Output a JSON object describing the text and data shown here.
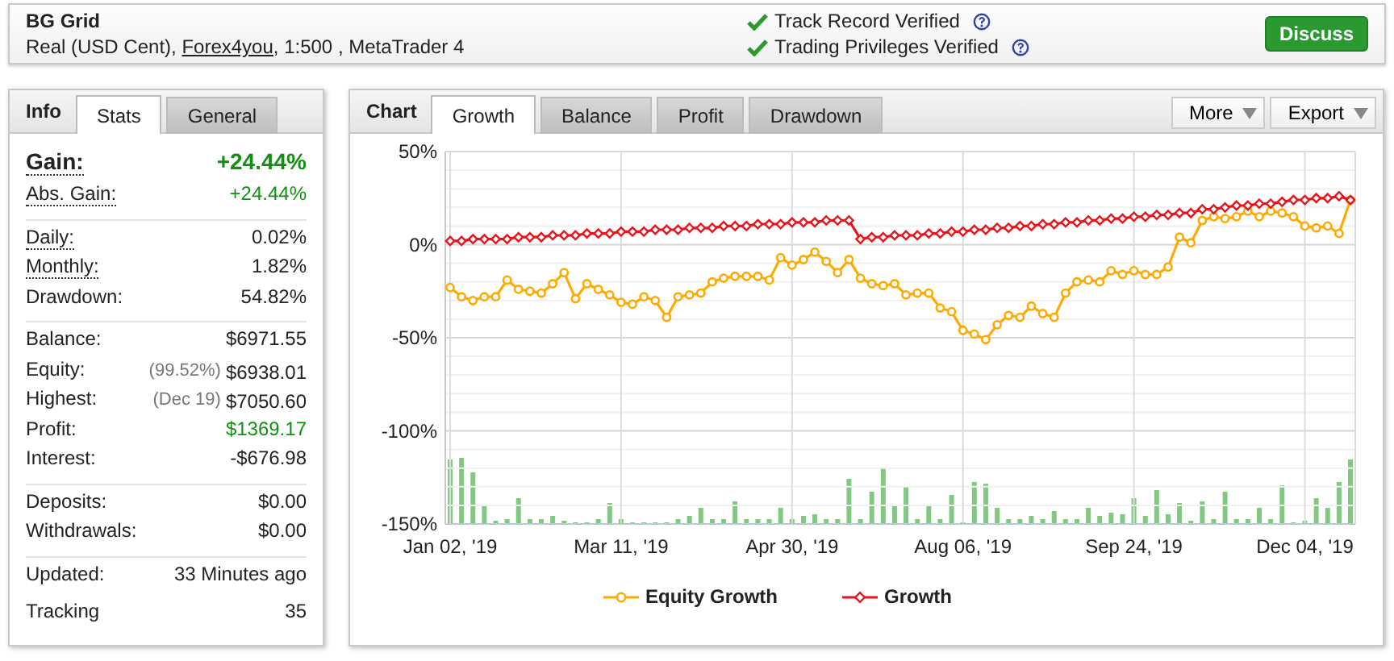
{
  "header": {
    "title": "BG Grid",
    "account": {
      "prefix": "Real (USD Cent), ",
      "link": "Forex4you",
      "suffix": ", 1:500 , MetaTrader 4"
    },
    "verifications": [
      {
        "label": "Track Record Verified",
        "verified": true
      },
      {
        "label": "Trading Privileges Verified",
        "verified": true
      }
    ],
    "discuss_button": "Discuss"
  },
  "info_panel": {
    "heading": "Info",
    "tabs": [
      {
        "label": "Stats",
        "selected": true
      },
      {
        "label": "General",
        "selected": false
      }
    ],
    "sections": [
      {
        "rows": [
          {
            "kind": "headline",
            "label": "Gain:",
            "dotted": true,
            "value": "+24.44%",
            "positive": true
          },
          {
            "kind": "row",
            "label": "Abs. Gain:",
            "dotted": true,
            "value": "+24.44%",
            "positive": true
          }
        ]
      },
      {
        "rows": [
          {
            "kind": "row",
            "label": "Daily:",
            "dotted": true,
            "value": "0.02%",
            "positive": false
          },
          {
            "kind": "row",
            "label": "Monthly:",
            "dotted": true,
            "value": "1.82%",
            "positive": false
          },
          {
            "kind": "row",
            "label": "Drawdown:",
            "dotted": false,
            "value": "54.82%",
            "positive": false
          }
        ]
      },
      {
        "rows": [
          {
            "kind": "row",
            "label": "Balance:",
            "dotted": false,
            "value": "$6971.55",
            "positive": false
          },
          {
            "kind": "row",
            "label": "Equity:",
            "dotted": false,
            "note": "(99.52%)",
            "value": "$6938.01",
            "positive": false
          },
          {
            "kind": "row",
            "label": "Highest:",
            "dotted": false,
            "note": "(Dec 19)",
            "value": "$7050.60",
            "positive": false
          },
          {
            "kind": "row",
            "label": "Profit:",
            "dotted": false,
            "value": "$1369.17",
            "positive": true
          },
          {
            "kind": "row",
            "label": "Interest:",
            "dotted": false,
            "value": "-$676.98",
            "positive": false
          }
        ]
      },
      {
        "rows": [
          {
            "kind": "row",
            "label": "Deposits:",
            "dotted": false,
            "value": "$0.00",
            "positive": false
          },
          {
            "kind": "row",
            "label": "Withdrawals:",
            "dotted": false,
            "value": "$0.00",
            "positive": false
          }
        ]
      },
      {
        "rows": [
          {
            "kind": "row",
            "label": "Updated:",
            "dotted": false,
            "value": "33 Minutes ago",
            "positive": false
          },
          {
            "kind": "row",
            "label": "Tracking",
            "dotted": false,
            "value": "35",
            "positive": false
          }
        ]
      }
    ]
  },
  "chart_panel": {
    "heading": "Chart",
    "tabs": [
      {
        "label": "Growth",
        "selected": true
      },
      {
        "label": "Balance",
        "selected": false
      },
      {
        "label": "Profit",
        "selected": false
      },
      {
        "label": "Drawdown",
        "selected": false
      }
    ],
    "menus": [
      "More",
      "Export"
    ],
    "chart_data": {
      "type": "line",
      "grid": true,
      "legend": "bottom",
      "categories": [
        "Jan 02, '19",
        null,
        null,
        null,
        null,
        null,
        null,
        null,
        null,
        null,
        null,
        null,
        null,
        null,
        null,
        "Mar 11, '19",
        null,
        null,
        null,
        null,
        null,
        null,
        null,
        null,
        null,
        null,
        null,
        null,
        null,
        null,
        "Apr 30, '19",
        null,
        null,
        null,
        null,
        null,
        null,
        null,
        null,
        null,
        null,
        null,
        null,
        null,
        null,
        "Aug 06, '19",
        null,
        null,
        null,
        null,
        null,
        null,
        null,
        null,
        null,
        null,
        null,
        null,
        null,
        null,
        "Sep 24, '19",
        null,
        null,
        null,
        null,
        null,
        null,
        null,
        null,
        null,
        null,
        null,
        null,
        null,
        null,
        "Dec 04, '19",
        null,
        null,
        null,
        null
      ],
      "ylim": [
        -150,
        50
      ],
      "yticks": [
        {
          "value": -150,
          "label": "-150%"
        },
        {
          "value": -100,
          "label": "-100%"
        },
        {
          "value": -50,
          "label": "-50%"
        },
        {
          "value": 0,
          "label": "0%"
        },
        {
          "value": 50,
          "label": "50%"
        }
      ],
      "series": [
        {
          "name": "Equity Growth",
          "color": "#ffaa00",
          "marker": "circle",
          "values": [
            -23,
            -28,
            -30,
            -28,
            -28,
            -19,
            -24,
            -25,
            -26,
            -21,
            -15,
            -29,
            -21,
            -24,
            -27,
            -31,
            -32,
            -28,
            -30,
            -39,
            -28,
            -27,
            -26,
            -20,
            -18,
            -17,
            -17,
            -17,
            -19,
            -7,
            -11,
            -8,
            -4,
            -9,
            -15,
            -8,
            -18,
            -21,
            -22,
            -21,
            -27,
            -26,
            -26,
            -34,
            -36,
            -46,
            -48,
            -51,
            -43,
            -38,
            -39,
            -33,
            -37,
            -39,
            -26,
            -20,
            -19,
            -20,
            -14,
            -16,
            -14,
            -16,
            -16,
            -12,
            4,
            1,
            13,
            15,
            14,
            15,
            18,
            15,
            18,
            17,
            15,
            10,
            9,
            10,
            6,
            24
          ]
        },
        {
          "name": "Growth",
          "color": "#e8141c",
          "marker": "diamond",
          "values": [
            2,
            2,
            3,
            3,
            3,
            3,
            4,
            4,
            4,
            5,
            5,
            5,
            6,
            6,
            6,
            7,
            7,
            7,
            8,
            8,
            8,
            9,
            9,
            9,
            10,
            10,
            10,
            11,
            11,
            11,
            12,
            12,
            12,
            13,
            13,
            13,
            3,
            4,
            4,
            5,
            5,
            5,
            6,
            6,
            7,
            7,
            8,
            8,
            9,
            9,
            10,
            10,
            11,
            11,
            12,
            12,
            13,
            13,
            14,
            14,
            15,
            15,
            16,
            16,
            17,
            17,
            19,
            19,
            20,
            21,
            21,
            22,
            22,
            23,
            24,
            24,
            25,
            25,
            26,
            24
          ]
        }
      ]
    }
  }
}
